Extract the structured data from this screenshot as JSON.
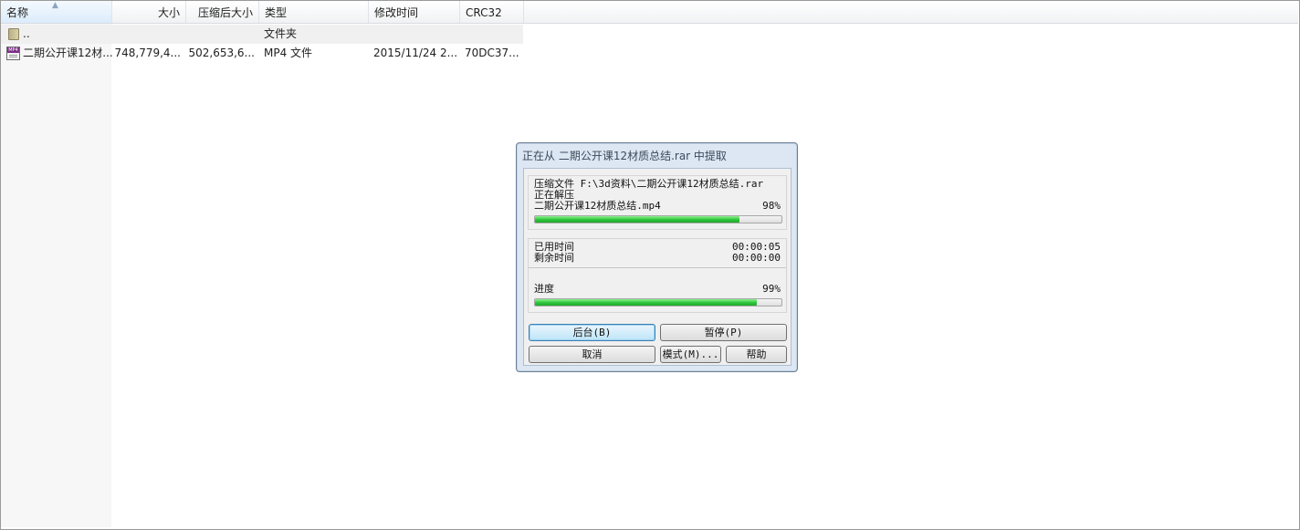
{
  "header": {
    "name": "名称",
    "size": "大小",
    "packed": "压缩后大小",
    "type": "类型",
    "modified": "修改时间",
    "crc": "CRC32"
  },
  "files": [
    {
      "name": "..",
      "size": "",
      "packed": "",
      "type": "文件夹",
      "modified": "",
      "crc": "",
      "icon": "folder-up-icon"
    },
    {
      "name": "二期公开课12材...",
      "size": "748,779,4...",
      "packed": "502,653,6...",
      "type": "MP4 文件",
      "modified": "2015/11/24 2...",
      "crc": "70DC37...",
      "icon": "mp4-file-icon"
    }
  ],
  "dialog": {
    "title": "正在从 二期公开课12材质总结.rar 中提取",
    "archive_line": "压缩文件 F:\\3d资料\\二期公开课12材质总结.rar",
    "status": "正在解压",
    "current_file": "二期公开课12材质总结.mp4",
    "file_percent": "98%",
    "file_progress": 0.83,
    "elapsed_label": "已用时间",
    "elapsed": "00:00:05",
    "remaining_label": "剩余时间",
    "remaining": "00:00:00",
    "progress_label": "进度",
    "total_percent": "99%",
    "total_progress": 0.9,
    "buttons": {
      "background": "后台(B)",
      "pause": "暂停(P)",
      "cancel": "取消",
      "mode": "模式(M)...",
      "help": "帮助"
    }
  }
}
